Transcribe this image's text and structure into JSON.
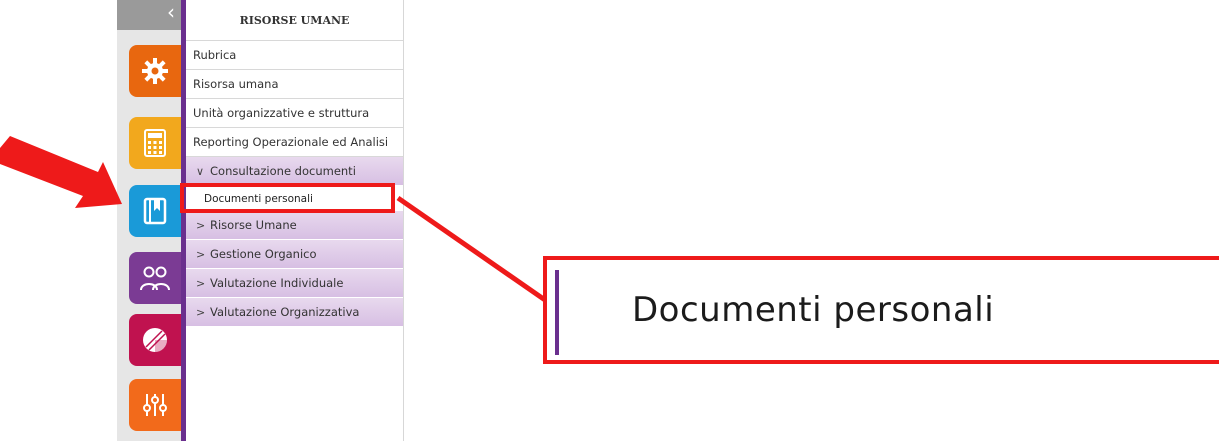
{
  "rail": {
    "back_icon": "chevron-left-icon",
    "apps": [
      {
        "icon": "gear-icon",
        "color": "#e8670f"
      },
      {
        "icon": "calculator-icon",
        "color": "#f2a81d"
      },
      {
        "icon": "book-icon",
        "color": "#1a9ad8"
      },
      {
        "icon": "people-icon",
        "color": "#7b3b94"
      },
      {
        "icon": "pie-chart-icon",
        "color": "#c0124f"
      },
      {
        "icon": "sliders-icon",
        "color": "#f26a1b"
      }
    ]
  },
  "menu": {
    "title": "RISORSE UMANE",
    "items": [
      "Rubrica",
      "Risorsa umana",
      "Unità organizzative e struttura",
      "Reporting Operazionale ed Analisi"
    ],
    "expanded_group": {
      "label": "Consultazione documenti",
      "chevron": "chevron-down-icon",
      "children": [
        "Documenti personali"
      ]
    },
    "collapsed_groups": [
      "Risorse Umane",
      "Gestione Organico",
      "Valutazione Individuale",
      "Valutazione Organizzativa"
    ]
  },
  "annotation": {
    "zoom_text": "Documenti personali",
    "highlight_color": "#ee1a1a",
    "arrow_icon": "red-arrow-icon"
  },
  "colors": {
    "accent": "#6a2f8e",
    "group_bg": "#d7bfe3"
  }
}
